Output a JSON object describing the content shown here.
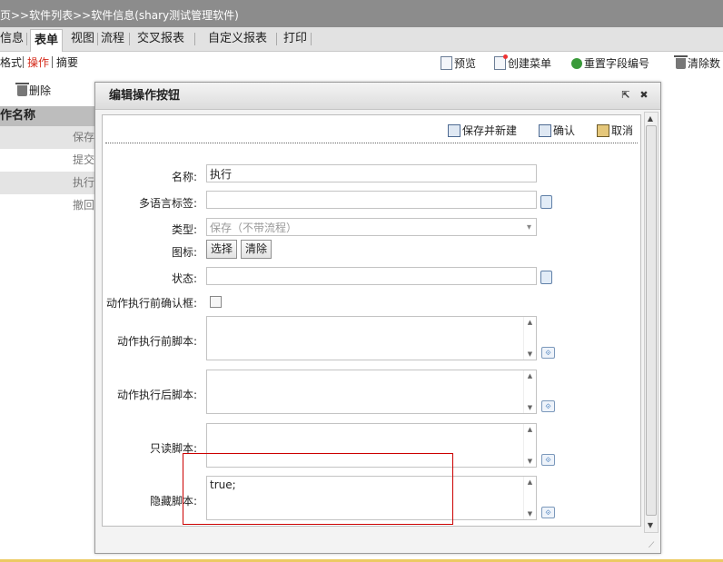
{
  "breadcrumb": "页>>软件列表>>软件信息(shary测试管理软件)",
  "tabs": [
    {
      "label": "信息"
    },
    {
      "label": "表单",
      "active": true
    },
    {
      "label": "视图"
    },
    {
      "label": "流程"
    },
    {
      "label": "交叉报表"
    },
    {
      "label": "自定义报表"
    },
    {
      "label": "打印"
    }
  ],
  "subtabs": [
    {
      "label": "格式"
    },
    {
      "label": "操作",
      "active": true
    },
    {
      "label": "摘要"
    }
  ],
  "toolbar": {
    "preview": "预览",
    "create_menu": "创建菜单",
    "reset_field_numbers": "重置字段编号",
    "clear": "清除数"
  },
  "left_panel": {
    "delete_label": "删除",
    "column_header": "作名称",
    "rows": [
      "保存",
      "提交",
      "执行",
      "撤回"
    ]
  },
  "dialog": {
    "title": "编辑操作按钮",
    "actions": {
      "save_and_new": "保存并新建",
      "confirm": "确认",
      "cancel": "取消"
    },
    "fields": {
      "name_label": "名称:",
      "name_value": "执行",
      "i18n_label": "多语言标签:",
      "i18n_value": "",
      "type_label": "类型:",
      "type_value": "保存（不带流程）",
      "icon_label": "图标:",
      "icon_select": "选择",
      "icon_clear": "清除",
      "status_label": "状态:",
      "status_value": "",
      "confirm_before_label": "动作执行前确认框:",
      "confirm_before_checked": false,
      "pre_script_label": "动作执行前脚本:",
      "pre_script_value": "",
      "post_script_label": "动作执行后脚本:",
      "post_script_value": "",
      "readonly_script_label": "只读脚本:",
      "readonly_script_value": "",
      "hidden_script_label": "隐藏脚本:",
      "hidden_script_value": "true;"
    }
  },
  "colors": {
    "active_subtab": "#d42a1a",
    "highlight_box": "#cc0000",
    "breadcrumb_bg": "#8c8c8c"
  }
}
